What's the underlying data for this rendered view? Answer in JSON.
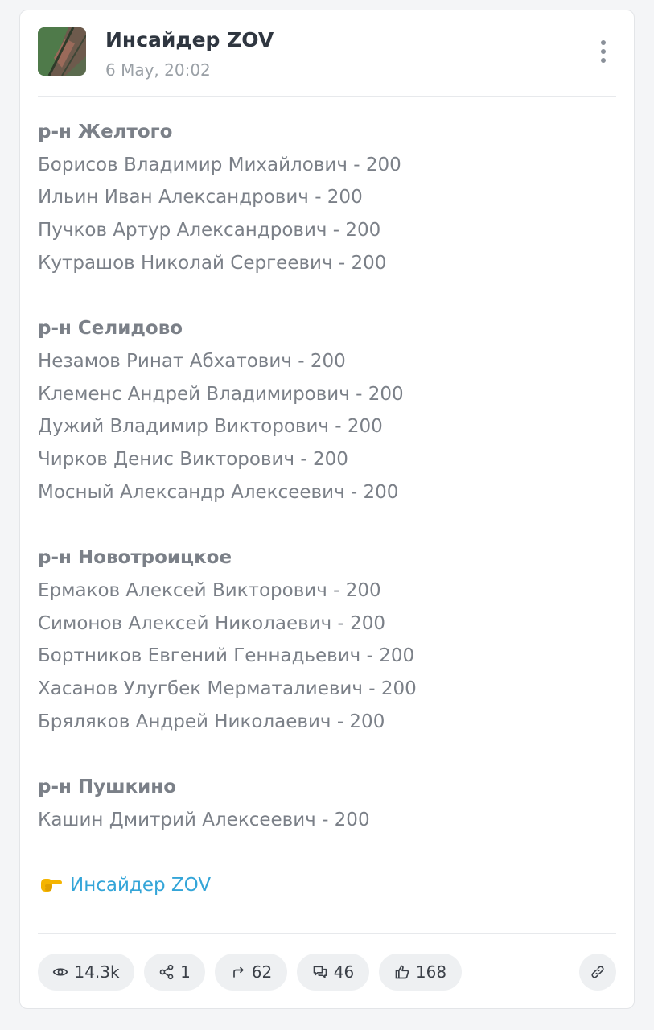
{
  "post": {
    "channel_name": "Инсайдер ZOV",
    "date": "6 May, 20:02",
    "menu_icon": "more-vertical-icon",
    "sections": [
      {
        "heading": "р-н Желтого",
        "entries": [
          "Борисов Владимир Михайлович - 200",
          "Ильин Иван Александрович - 200",
          "Пучков Артур Александрович - 200",
          "Кутрашов Николай Сергеевич - 200"
        ]
      },
      {
        "heading": "р-н Селидово",
        "entries": [
          "Незамов Ринат Абхатович - 200",
          "Клеменс Андрей Владимирович - 200",
          "Дужий Владимир Викторович - 200",
          "Чирков Денис Викторович - 200",
          "Мосный Александр Алексеевич - 200"
        ]
      },
      {
        "heading": "р-н Новотроицкое",
        "entries": [
          "Ермаков Алексей Викторович - 200",
          "Симонов Алексей Николаевич - 200",
          "Бортников Евгений Геннадьевич - 200",
          "Хасанов Улугбек Мерматалиевич - 200",
          "Бряляков Андрей Николаевич - 200"
        ]
      },
      {
        "heading": "р-н Пушкино",
        "entries": [
          "Кашин Дмитрий Алексеевич - 200"
        ]
      }
    ],
    "footer_emoji": "👉",
    "footer_link_text": "Инсайдер ZOV",
    "link_color": "#34a5d8"
  },
  "stats": {
    "views": {
      "icon": "eye-icon",
      "value": "14.3k"
    },
    "shares": {
      "icon": "share-icon",
      "value": "1"
    },
    "forwards": {
      "icon": "forward-icon",
      "value": "62"
    },
    "comments": {
      "icon": "comments-icon",
      "value": "46"
    },
    "likes": {
      "icon": "thumbs-up-icon",
      "value": "168"
    },
    "copy_link_icon": "link-icon"
  }
}
